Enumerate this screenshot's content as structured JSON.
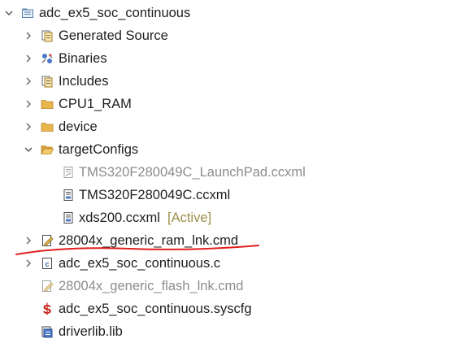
{
  "project": {
    "name": "adc_ex5_soc_continuous",
    "expanded": true
  },
  "items": [
    {
      "label": "Generated Source",
      "icon": "generated-source-folder-icon",
      "expanded": false
    },
    {
      "label": "Binaries",
      "icon": "binaries-icon",
      "expanded": false
    },
    {
      "label": "Includes",
      "icon": "includes-icon",
      "expanded": false
    },
    {
      "label": "CPU1_RAM",
      "icon": "folder-icon",
      "expanded": false
    },
    {
      "label": "device",
      "icon": "folder-icon",
      "expanded": false
    },
    {
      "label": "targetConfigs",
      "icon": "open-folder-icon",
      "expanded": true
    },
    {
      "label": "TMS320F280049C_LaunchPad.ccxml",
      "icon": "ccxml-file-icon",
      "greyed": true
    },
    {
      "label": "TMS320F280049C.ccxml",
      "icon": "ccxml-file-icon"
    },
    {
      "label": "xds200.ccxml",
      "icon": "ccxml-file-icon",
      "suffix": "[Active]"
    },
    {
      "label": "28004x_generic_ram_lnk.cmd",
      "icon": "linker-cmd-file-icon",
      "expanded": false,
      "annotated": true
    },
    {
      "label": "adc_ex5_soc_continuous.c",
      "icon": "c-source-file-icon",
      "expanded": false
    },
    {
      "label": "28004x_generic_flash_lnk.cmd",
      "icon": "linker-cmd-file-icon",
      "greyed": true
    },
    {
      "label": "adc_ex5_soc_continuous.syscfg",
      "icon": "syscfg-file-icon"
    },
    {
      "label": "driverlib.lib",
      "icon": "library-file-icon"
    }
  ],
  "colors": {
    "text": "#1e1e1e",
    "greyed_text": "#8c8c8c",
    "active_decoration": "#9b8f4a",
    "annotation_stroke": "#e0201e",
    "folder": "#e8b64a"
  }
}
